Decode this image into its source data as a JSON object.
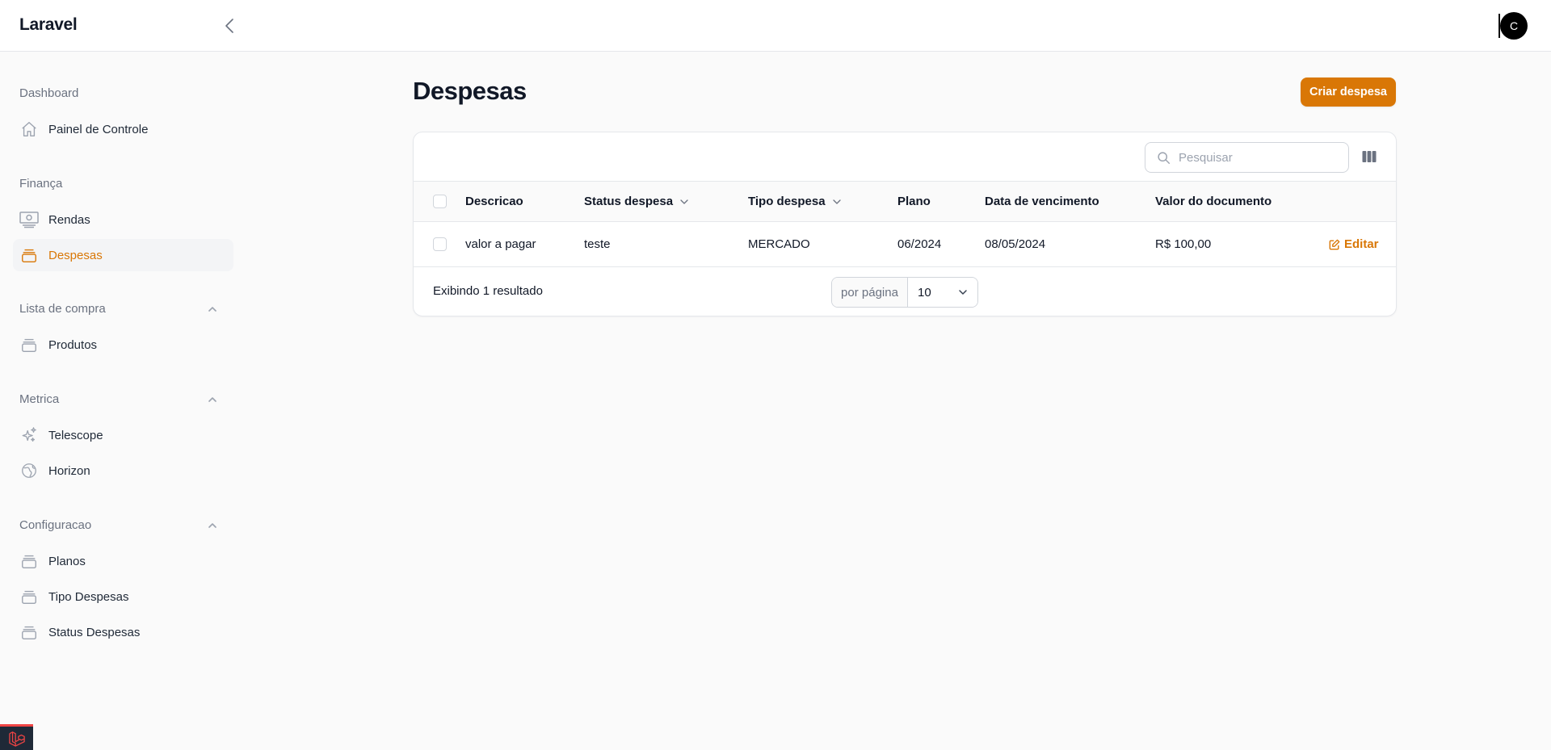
{
  "app": {
    "brand": "Laravel",
    "user_initial": "C"
  },
  "sidebar": {
    "groups": [
      {
        "label": "Dashboard",
        "items": [
          {
            "label": "Painel de Controle",
            "icon": "home-icon"
          }
        ]
      },
      {
        "label": "Finança",
        "items": [
          {
            "label": "Rendas",
            "icon": "banknotes-icon"
          },
          {
            "label": "Despesas",
            "icon": "rectangle-stack-icon",
            "active": true
          }
        ]
      },
      {
        "label": "Lista de compra",
        "collapsible": true,
        "items": [
          {
            "label": "Produtos",
            "icon": "rectangle-stack-icon"
          }
        ]
      },
      {
        "label": "Metrica",
        "collapsible": true,
        "items": [
          {
            "label": "Telescope",
            "icon": "sparkles-icon"
          },
          {
            "label": "Horizon",
            "icon": "globe-icon"
          }
        ]
      },
      {
        "label": "Configuracao",
        "collapsible": true,
        "items": [
          {
            "label": "Planos",
            "icon": "rectangle-stack-icon"
          },
          {
            "label": "Tipo Despesas",
            "icon": "rectangle-stack-icon"
          },
          {
            "label": "Status Despesas",
            "icon": "rectangle-stack-icon"
          }
        ]
      }
    ]
  },
  "page": {
    "title": "Despesas",
    "create_button": "Criar despesa"
  },
  "table": {
    "search_placeholder": "Pesquisar",
    "columns": [
      "Descricao",
      "Status despesa",
      "Tipo despesa",
      "Plano",
      "Data de vencimento",
      "Valor do documento"
    ],
    "rows": [
      {
        "descricao": "valor a pagar",
        "status": "teste",
        "tipo": "MERCADO",
        "plano": "06/2024",
        "vencimento": "08/05/2024",
        "valor": "R$ 100,00",
        "action": "Editar"
      }
    ],
    "footer": {
      "result_text": "Exibindo 1 resultado",
      "per_page_label": "por página",
      "per_page_value": "10"
    }
  },
  "colors": {
    "accent": "#d97706",
    "active_bg": "#f3f4f6"
  }
}
